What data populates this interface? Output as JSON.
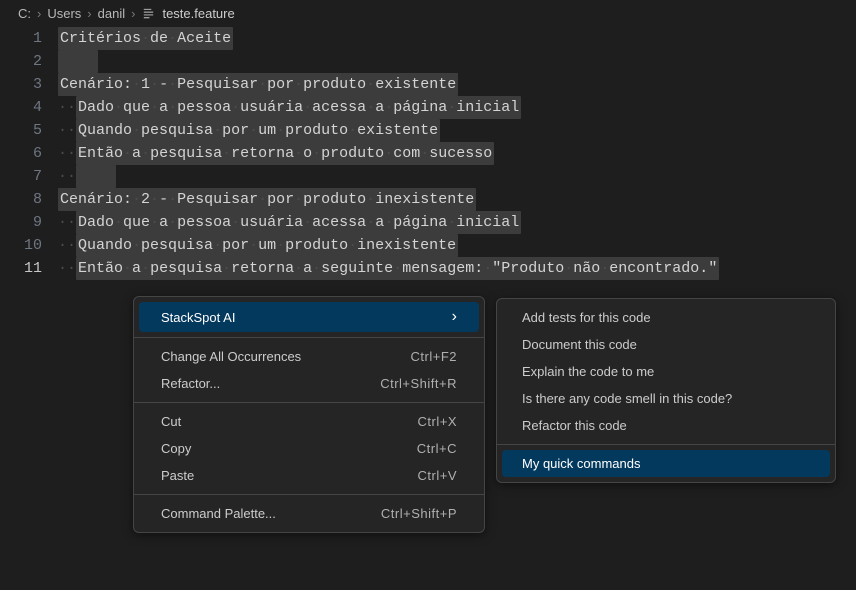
{
  "breadcrumbs": {
    "parts": [
      "C:",
      "Users",
      "danil"
    ],
    "file": "teste.feature"
  },
  "editor": {
    "lines": [
      {
        "n": 1,
        "text": "Critérios de Aceite",
        "highlight": true,
        "indent": 0,
        "trailingHighlight": false
      },
      {
        "n": 2,
        "text": "",
        "highlight": true,
        "indent": 0,
        "trailingHighlight": true
      },
      {
        "n": 3,
        "text": "Cenário: 1 - Pesquisar por produto existente",
        "highlight": true,
        "indent": 0,
        "trailingHighlight": false
      },
      {
        "n": 4,
        "text": "Dado que a pessoa usuária acessa a página inicial",
        "highlight": true,
        "indent": 1,
        "trailingHighlight": false
      },
      {
        "n": 5,
        "text": "Quando pesquisa por um produto existente",
        "highlight": true,
        "indent": 1,
        "trailingHighlight": false
      },
      {
        "n": 6,
        "text": "Então a pesquisa retorna o produto com sucesso",
        "highlight": true,
        "indent": 1,
        "trailingHighlight": false
      },
      {
        "n": 7,
        "text": "",
        "highlight": true,
        "indent": 1,
        "trailingHighlight": true
      },
      {
        "n": 8,
        "text": "Cenário: 2 - Pesquisar por produto inexistente",
        "highlight": true,
        "indent": 0,
        "trailingHighlight": false
      },
      {
        "n": 9,
        "text": "Dado que a pessoa usuária acessa a página inicial",
        "highlight": true,
        "indent": 1,
        "trailingHighlight": false
      },
      {
        "n": 10,
        "text": "Quando pesquisa por um produto inexistente",
        "highlight": true,
        "indent": 1,
        "trailingHighlight": false
      },
      {
        "n": 11,
        "text": "Então a pesquisa retorna a seguinte mensagem: \"Produto não encontrado.\"",
        "highlight": true,
        "indent": 1,
        "trailingHighlight": false,
        "active": true
      }
    ]
  },
  "contextMenu": {
    "items": [
      {
        "label": "StackSpot AI",
        "type": "submenu",
        "hovered": true
      },
      {
        "type": "sep"
      },
      {
        "label": "Change All Occurrences",
        "shortcut": "Ctrl+F2"
      },
      {
        "label": "Refactor...",
        "shortcut": "Ctrl+Shift+R"
      },
      {
        "type": "sep"
      },
      {
        "label": "Cut",
        "shortcut": "Ctrl+X"
      },
      {
        "label": "Copy",
        "shortcut": "Ctrl+C"
      },
      {
        "label": "Paste",
        "shortcut": "Ctrl+V"
      },
      {
        "type": "sep"
      },
      {
        "label": "Command Palette...",
        "shortcut": "Ctrl+Shift+P"
      }
    ]
  },
  "subMenu": {
    "items": [
      {
        "label": "Add tests for this code"
      },
      {
        "label": "Document this code"
      },
      {
        "label": "Explain the code to me"
      },
      {
        "label": "Is there any code smell in this code?"
      },
      {
        "label": "Refactor this code"
      },
      {
        "type": "sep"
      },
      {
        "label": "My quick commands",
        "hovered": true
      }
    ]
  }
}
